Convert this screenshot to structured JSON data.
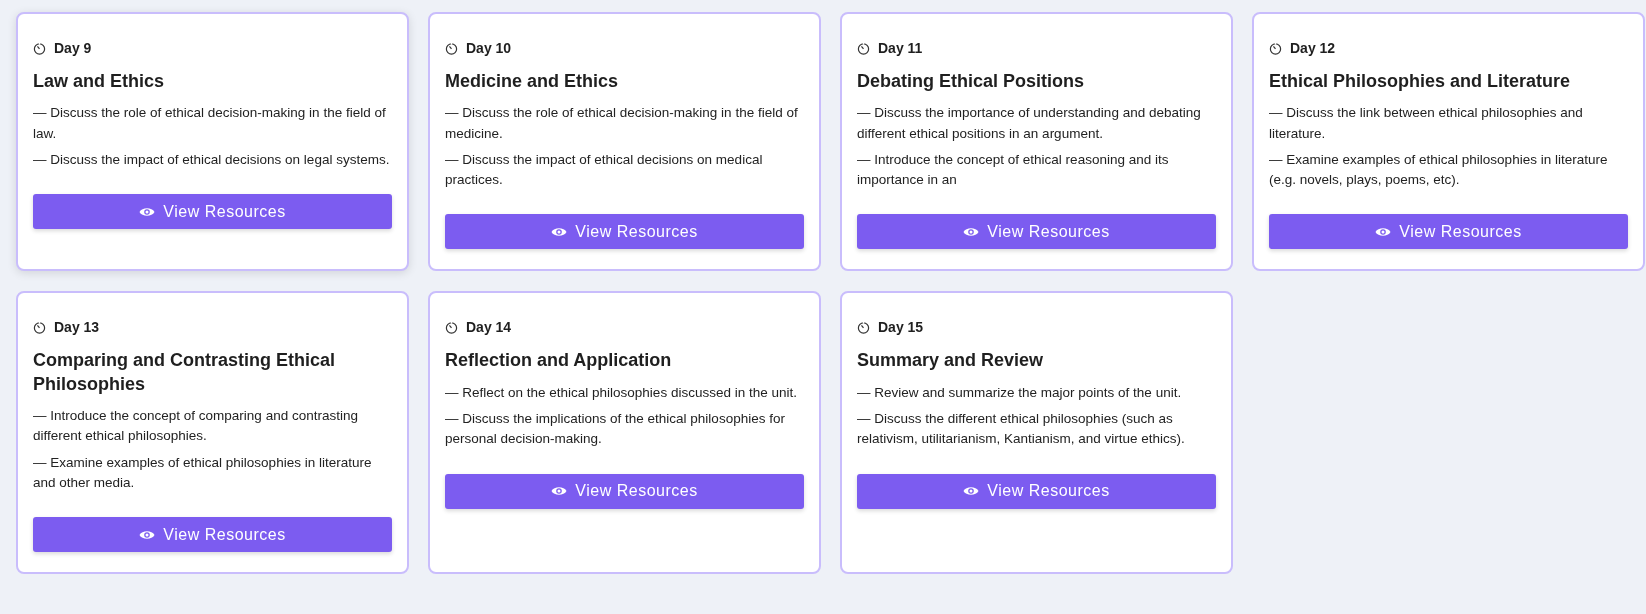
{
  "cards": [
    {
      "day": "Day 9",
      "title": "Law and Ethics",
      "points": [
        "— Discuss the role of ethical decision-making in the field of law.",
        "— Discuss the impact of ethical decisions on legal systems."
      ],
      "button": "View Resources"
    },
    {
      "day": "Day 10",
      "title": "Medicine and Ethics",
      "points": [
        "— Discuss the role of ethical decision-making in the field of medicine.",
        "— Discuss the impact of ethical decisions on medical practices."
      ],
      "button": "View Resources"
    },
    {
      "day": "Day 11",
      "title": "Debating Ethical Positions",
      "points": [
        "— Discuss the importance of understanding and debating different ethical positions in an argument.",
        "— Introduce the concept of ethical reasoning and its importance in an"
      ],
      "button": "View Resources"
    },
    {
      "day": "Day 12",
      "title": "Ethical Philosophies and Literature",
      "points": [
        "— Discuss the link between ethical philosophies and literature.",
        "— Examine examples of ethical philosophies in literature (e.g. novels, plays, poems, etc)."
      ],
      "button": "View Resources"
    },
    {
      "day": "Day 13",
      "title": "Comparing and Contrasting Ethical Philosophies",
      "points": [
        "— Introduce the concept of comparing and contrasting different ethical philosophies.",
        "— Examine examples of ethical philosophies in literature and other media."
      ],
      "button": "View Resources"
    },
    {
      "day": "Day 14",
      "title": "Reflection and Application",
      "points": [
        "— Reflect on the ethical philosophies discussed in the unit.",
        "— Discuss the implications of the ethical philosophies for personal decision-making."
      ],
      "button": "View Resources"
    },
    {
      "day": "Day 15",
      "title": "Summary and Review",
      "points": [
        "— Review and summarize the major points of the unit.",
        "— Discuss the different ethical philosophies (such as relativism, utilitarianism, Kantianism, and virtue ethics)."
      ],
      "button": "View Resources"
    }
  ]
}
